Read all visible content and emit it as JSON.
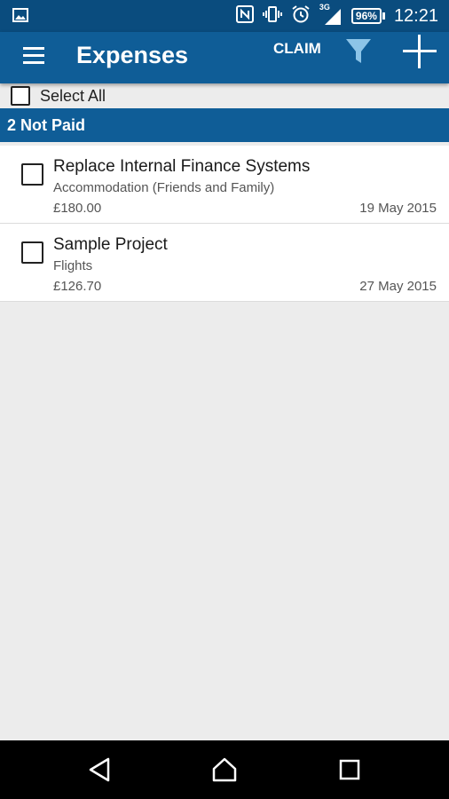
{
  "status_bar": {
    "time": "12:21",
    "battery": "96%",
    "signal_label": "3G"
  },
  "app_bar": {
    "title": "Expenses",
    "claim_label": "CLAIM"
  },
  "select_all": {
    "label": "Select All"
  },
  "group": {
    "label": "2 Not Paid"
  },
  "items": [
    {
      "title": "Replace Internal Finance Systems",
      "category": "Accommodation (Friends and Family)",
      "amount": "£180.00",
      "date": "19 May 2015"
    },
    {
      "title": "Sample Project",
      "category": "Flights",
      "amount": "£126.70",
      "date": "27 May 2015"
    }
  ],
  "colors": {
    "status_bar": "#0a4c7e",
    "app_bar": "#0f5d97",
    "filter_icon": "#8cc4e8",
    "background": "#ececec"
  }
}
